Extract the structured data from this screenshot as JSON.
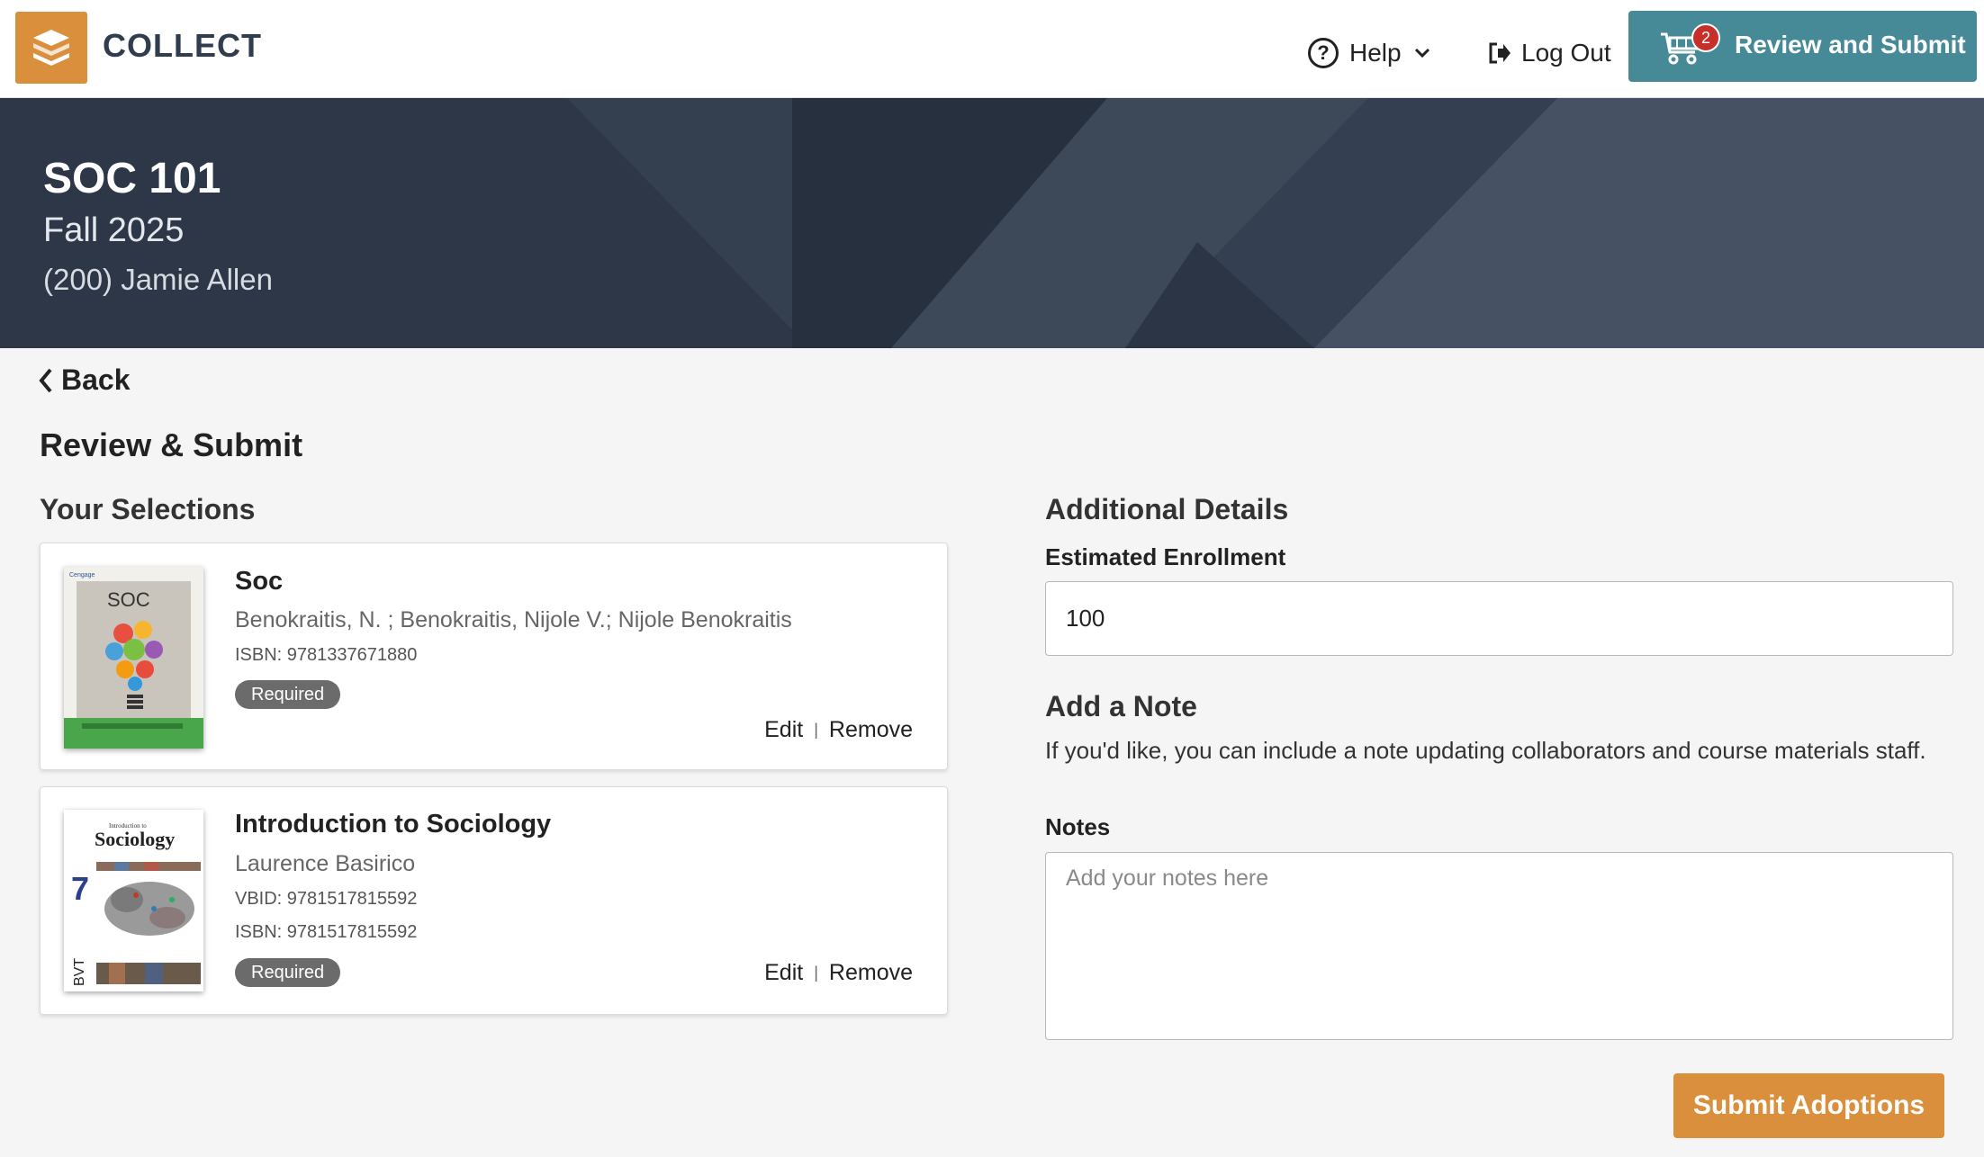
{
  "header": {
    "brand": "COLLECT",
    "help_label": "Help",
    "logout_label": "Log Out",
    "review_label": "Review and Submit",
    "cart_count": "2",
    "colors": {
      "accent_orange": "#d98f3b",
      "teal": "#468a98",
      "badge_red": "#c62f2a",
      "banner": "#2d3748"
    }
  },
  "course": {
    "code": "SOC 101",
    "term": "Fall 2025",
    "instructor": "(200) Jamie Allen"
  },
  "nav": {
    "back_label": "Back"
  },
  "page": {
    "title": "Review & Submit",
    "selections_heading": "Your Selections",
    "details_heading": "Additional Details"
  },
  "selections": [
    {
      "title": "Soc",
      "authors": "Benokraitis, N. ; Benokraitis, Nijole V.; Nijole Benokraitis",
      "isbn": "ISBN: 9781337671880",
      "status": "Required",
      "edit_label": "Edit",
      "separator": "|",
      "remove_label": "Remove",
      "cover_text": "SOC",
      "cover_publisher": "Cengage"
    },
    {
      "title": "Introduction to Sociology",
      "authors": "Laurence Basirico",
      "vbid": "VBID: 9781517815592",
      "isbn": "ISBN: 9781517815592",
      "status": "Required",
      "edit_label": "Edit",
      "separator": "|",
      "remove_label": "Remove",
      "cover_text": "Sociology",
      "cover_subtitle": "Introduction to",
      "cover_edition": "7",
      "cover_publisher": "BVT"
    }
  ],
  "details": {
    "enrollment_label": "Estimated Enrollment",
    "enrollment_value": "100",
    "note_heading": "Add a Note",
    "note_description": "If you'd like, you can include a note updating collaborators and course materials staff.",
    "notes_label": "Notes",
    "notes_placeholder": "Add your notes here",
    "notes_value": ""
  },
  "actions": {
    "submit_label": "Submit Adoptions"
  }
}
